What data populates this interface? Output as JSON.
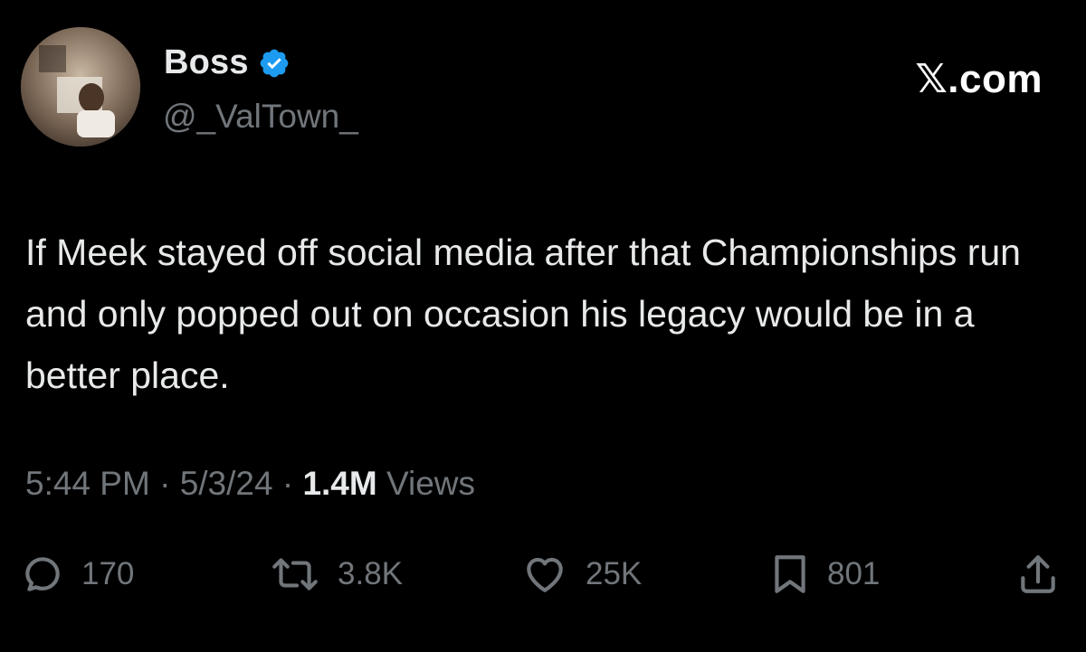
{
  "author": {
    "display_name": "Boss",
    "handle": "@_ValTown_",
    "verified_icon": "verified-badge-icon",
    "verified_color": "#1d9bf0"
  },
  "brand": "𝕏.com",
  "tweet": {
    "text": "If Meek stayed off social media after that Championships run and only popped out on occasion his legacy would be in a better place."
  },
  "meta": {
    "time": "5:44 PM",
    "separator1": " · ",
    "date": "5/3/24",
    "separator2": " · ",
    "views_count": "1.4M",
    "views_label": " Views"
  },
  "actions": {
    "replies": {
      "icon": "reply-icon",
      "count": "170"
    },
    "reposts": {
      "icon": "repost-icon",
      "count": "3.8K"
    },
    "likes": {
      "icon": "heart-icon",
      "count": "25K"
    },
    "bookmarks": {
      "icon": "bookmark-icon",
      "count": "801"
    },
    "share": {
      "icon": "share-icon"
    }
  },
  "colors": {
    "background": "#000000",
    "primary_text": "#e7e9ea",
    "secondary_text": "#71767b",
    "accent": "#1d9bf0"
  }
}
